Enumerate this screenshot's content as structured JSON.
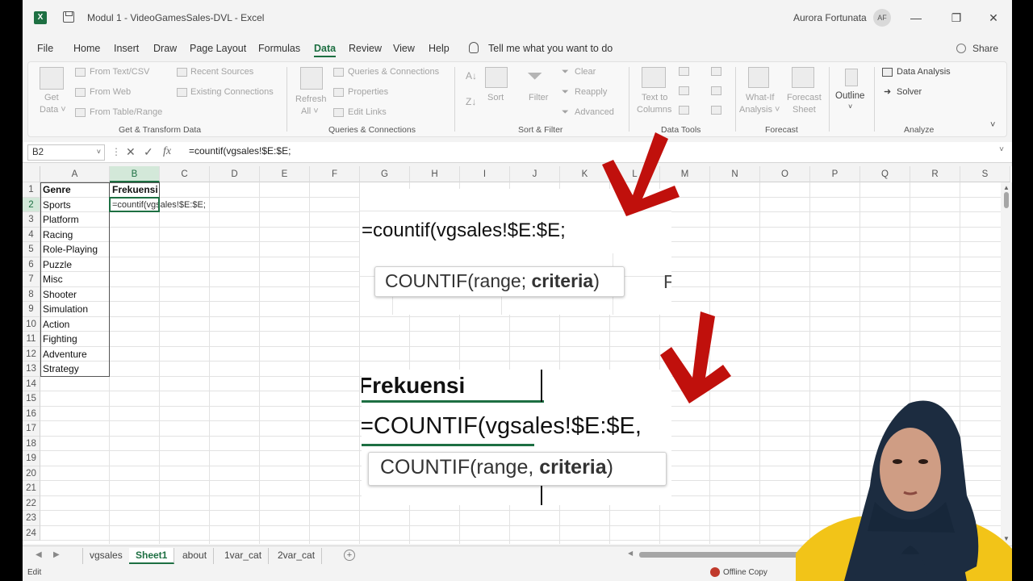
{
  "window": {
    "title": "Modul 1 - VideoGamesSales-DVL  -  Excel",
    "user": "Aurora Fortunata",
    "user_initials": "AF"
  },
  "menu": {
    "tabs": [
      "File",
      "Home",
      "Insert",
      "Draw",
      "Page Layout",
      "Formulas",
      "Data",
      "Review",
      "View",
      "Help"
    ],
    "active": "Data",
    "tell_me": "Tell me what you want to do",
    "share": "Share"
  },
  "ribbon": {
    "get_transform": {
      "get_data": "Get",
      "get_data_2": "Data ˅",
      "from_text": "From Text/CSV",
      "from_web": "From Web",
      "from_table": "From Table/Range",
      "recent_sources": "Recent Sources",
      "existing_connections": "Existing Connections",
      "label": "Get & Transform Data"
    },
    "queries": {
      "refresh": "Refresh",
      "refresh_2": "All ˅",
      "queries_connections": "Queries & Connections",
      "properties": "Properties",
      "edit_links": "Edit Links",
      "label": "Queries & Connections"
    },
    "sort_filter": {
      "sort": "Sort",
      "filter": "Filter",
      "clear": "Clear",
      "reapply": "Reapply",
      "advanced": "Advanced",
      "label": "Sort & Filter"
    },
    "data_tools": {
      "text_to_columns": "Text to",
      "text_to_columns_2": "Columns",
      "label": "Data Tools"
    },
    "forecast": {
      "what_if": "What-If",
      "what_if_2": "Analysis ˅",
      "forecast_sheet": "Forecast",
      "forecast_sheet_2": "Sheet",
      "label": "Forecast"
    },
    "outline": {
      "label": "Outline"
    },
    "analyze": {
      "data_analysis": "Data Analysis",
      "solver": "Solver",
      "label": "Analyze"
    }
  },
  "formula_bar": {
    "name_box": "B2",
    "formula": "=countif(vgsales!$E:$E;",
    "fx": "fx"
  },
  "grid": {
    "columns": [
      "A",
      "B",
      "C",
      "D",
      "E",
      "F",
      "G",
      "H",
      "I",
      "J",
      "K",
      "L",
      "M",
      "N",
      "O",
      "P",
      "Q",
      "R",
      "S"
    ],
    "rows": [
      "1",
      "2",
      "3",
      "4",
      "5",
      "6",
      "7",
      "8",
      "9",
      "10",
      "11",
      "12",
      "13",
      "14",
      "15",
      "16",
      "17",
      "18",
      "19",
      "20",
      "21",
      "22",
      "23",
      "24"
    ],
    "header_a": "Genre",
    "header_b": "Frekuensi",
    "genres": [
      "Sports",
      "Platform",
      "Racing",
      "Role-Playing",
      "Puzzle",
      "Misc",
      "Shooter",
      "Simulation",
      "Action",
      "Fighting",
      "Adventure",
      "Strategy"
    ],
    "b2_formula": "=countif(vgsales!$E:$E;"
  },
  "zoom_top": {
    "formula": "=countif(vgsales!$E:$E;",
    "tooltip_prefix": "COUNTIF(range; ",
    "tooltip_bold": "criteria",
    "tooltip_suffix": ")",
    "edge_letter": "F"
  },
  "zoom_bottom": {
    "header": "Frekuensi",
    "formula": "=COUNTIF(vgsales!$E:$E,",
    "tooltip_prefix": "COUNTIF(range, ",
    "tooltip_bold": "criteria",
    "tooltip_suffix": ")"
  },
  "sheets": {
    "tabs": [
      "vgsales",
      "Sheet1",
      "about",
      "1var_cat",
      "2var_cat"
    ],
    "active": "Sheet1"
  },
  "status": {
    "mode": "Edit",
    "offline": "Offline Copy"
  },
  "colors": {
    "excel_green": "#1d6f42",
    "arrow_red": "#c0100c"
  }
}
